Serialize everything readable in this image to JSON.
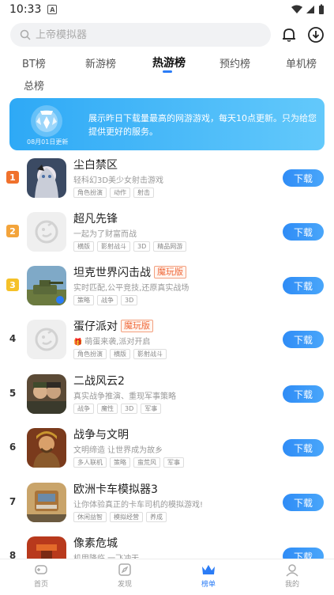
{
  "status": {
    "time": "10:33",
    "a_label": "A"
  },
  "search": {
    "placeholder": "上帝模拟器"
  },
  "tabs": [
    "BT榜",
    "新游榜",
    "热游榜",
    "预约榜",
    "单机榜",
    "总榜"
  ],
  "active_tab": "热游榜",
  "banner": {
    "date": "08月01日更新",
    "description": "展示昨日下载量最高的网游游戏，每天10点更新。只为给您提供更好的服务。"
  },
  "download_label": "下载",
  "games": [
    {
      "rank": "1",
      "name": "尘白禁区",
      "badge": "",
      "desc": "轻科幻3D美少女射击游戏",
      "gift": false,
      "tags": [
        "角色扮演",
        "动作",
        "射击"
      ]
    },
    {
      "rank": "2",
      "name": "超凡先锋",
      "badge": "",
      "desc": "一起为了财富而战",
      "gift": false,
      "tags": [
        "横版",
        "影射战斗",
        "3D",
        "精品网游"
      ]
    },
    {
      "rank": "3",
      "name": "坦克世界闪击战",
      "badge": "魔玩版",
      "desc": "实时匹配,公平竞技,还原真实战场",
      "gift": false,
      "tags": [
        "策略",
        "战争",
        "3D"
      ]
    },
    {
      "rank": "4",
      "name": "蛋仔派对",
      "badge": "魔玩版",
      "desc": "萌蛋来袭,派对开启",
      "gift": true,
      "tags": [
        "角色扮演",
        "横版",
        "影射战斗"
      ]
    },
    {
      "rank": "5",
      "name": "二战风云2",
      "badge": "",
      "desc": "真实战争推演、重现军事策略",
      "gift": false,
      "tags": [
        "战争",
        "魔性",
        "3D",
        "军事"
      ]
    },
    {
      "rank": "6",
      "name": "战争与文明",
      "badge": "",
      "desc": "文明缔造 让世界成为故乡",
      "gift": false,
      "tags": [
        "多人联机",
        "策略",
        "蛮荒风",
        "军事"
      ]
    },
    {
      "rank": "7",
      "name": "欧洲卡车模拟器3",
      "badge": "",
      "desc": "让你体验真正的卡车司机的模拟游戏!",
      "gift": false,
      "tags": [
        "休闲益智",
        "模拟经营",
        "养成"
      ]
    },
    {
      "rank": "8",
      "name": "像素危城",
      "badge": "",
      "desc": "机甲降临 一飞冲天",
      "gift": false,
      "tags": []
    }
  ],
  "bottom_nav": [
    "首页",
    "发现",
    "榜单",
    "我的"
  ],
  "colors": {
    "accent": "#2b7cf6",
    "rank1": "#f0712c",
    "rank2": "#f3a43b",
    "rank3": "#f5c128",
    "badge": "#f06a3b"
  }
}
